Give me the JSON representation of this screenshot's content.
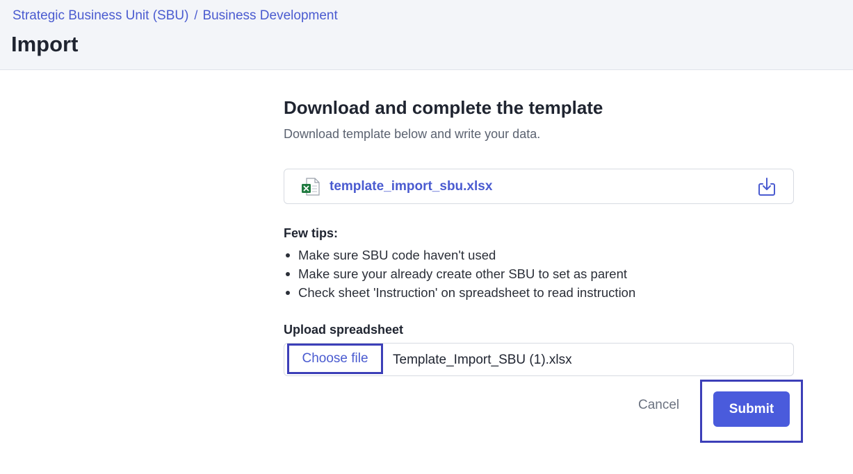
{
  "header": {
    "breadcrumb": [
      "Strategic Business Unit (SBU)",
      "Business Development"
    ],
    "breadcrumb_separator": "/",
    "title": "Import"
  },
  "template": {
    "title": "Download and complete the template",
    "subtitle": "Download template below and write your data.",
    "file_name": "template_import_sbu.xlsx",
    "file_icon": "excel-file-icon",
    "download_icon": "download-icon"
  },
  "tips": {
    "title": "Few tips:",
    "items": [
      "Make sure SBU code haven't used",
      "Make sure your already create other SBU to set as parent",
      "Check sheet 'Instruction' on spreadsheet to read instruction"
    ]
  },
  "upload": {
    "label": "Upload spreadsheet",
    "choose_label": "Choose file",
    "selected_file": "Template_Import_SBU (1).xlsx"
  },
  "actions": {
    "cancel_label": "Cancel",
    "submit_label": "Submit"
  },
  "colors": {
    "accent": "#4a5bdc",
    "link": "#4a5bd0",
    "highlight": "#3c3fb8",
    "excel_green": "#1f7a3f",
    "header_bg": "#f3f5f9"
  }
}
